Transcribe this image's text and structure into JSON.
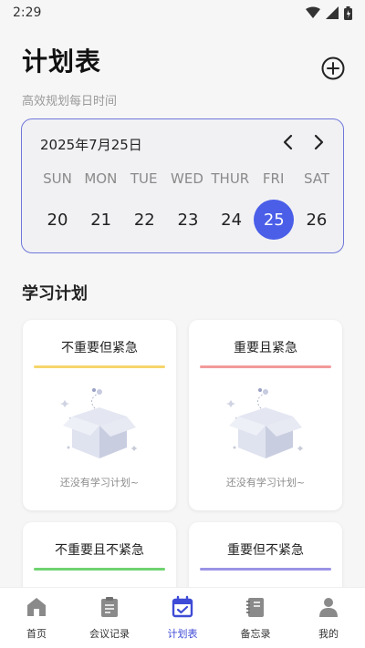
{
  "status": {
    "time": "2:29"
  },
  "header": {
    "title": "计划表",
    "subtitle": "高效规划每日时间"
  },
  "calendar": {
    "date_label": "2025年7月25日",
    "weekdays": [
      "SUN",
      "MON",
      "TUE",
      "WED",
      "THUR",
      "FRI",
      "SAT"
    ],
    "days": [
      "20",
      "21",
      "22",
      "23",
      "24",
      "25",
      "26"
    ],
    "selected_day": "25",
    "accent": "#4a5ee8"
  },
  "section": {
    "title": "学习计划"
  },
  "quadrants": [
    {
      "label": "不重要但紧急",
      "color": "#f5d56b",
      "empty_text": "还没有学习计划~"
    },
    {
      "label": "重要且紧急",
      "color": "#f39a9a",
      "empty_text": "还没有学习计划~"
    },
    {
      "label": "不重要且不紧急",
      "color": "#6fd36f"
    },
    {
      "label": "重要但不紧急",
      "color": "#9b93e6"
    }
  ],
  "tabs": [
    {
      "label": "首页",
      "icon": "home-icon"
    },
    {
      "label": "会议记录",
      "icon": "clipboard-icon"
    },
    {
      "label": "计划表",
      "icon": "calendar-check-icon",
      "active": true
    },
    {
      "label": "备忘录",
      "icon": "notebook-icon"
    },
    {
      "label": "我的",
      "icon": "person-icon"
    }
  ]
}
